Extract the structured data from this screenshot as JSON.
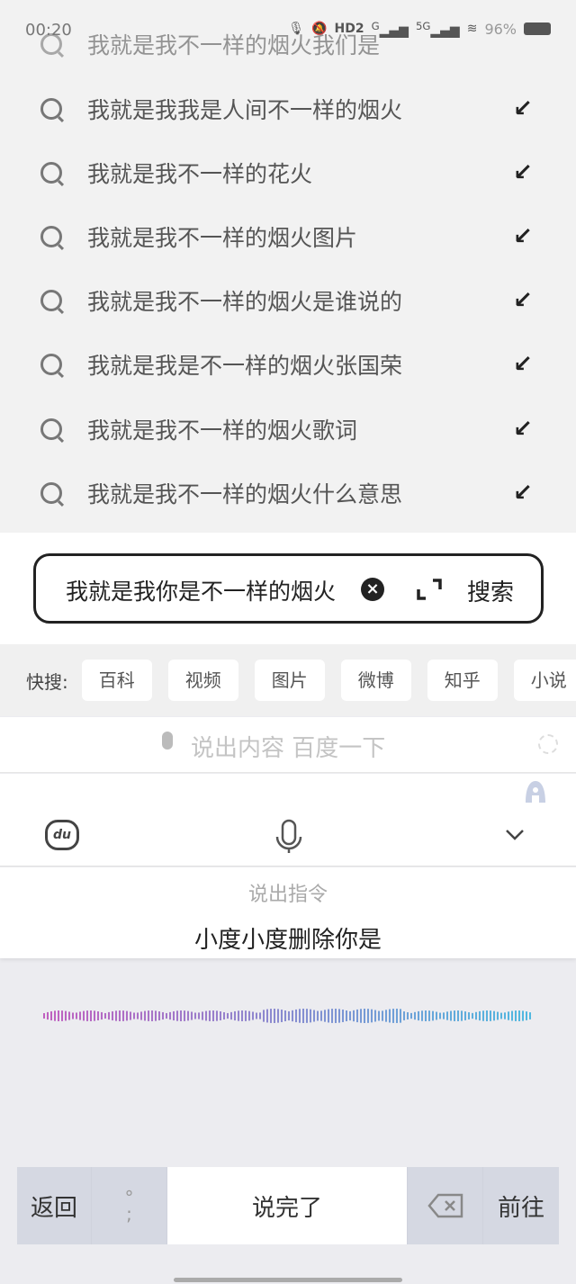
{
  "status_bar": {
    "time": "00:20",
    "signal_1": "HD2",
    "signal_2": "G",
    "signal_3": "5G",
    "battery": "96%"
  },
  "suggestions": [
    "我就是我不一样的烟火我们是",
    "我就是我我是人间不一样的烟火",
    "我就是我不一样的花火",
    "我就是我不一样的烟火图片",
    "我就是我不一样的烟火是谁说的",
    "我就是我是不一样的烟火张国荣",
    "我就是我不一样的烟火歌词",
    "我就是我不一样的烟火什么意思"
  ],
  "search": {
    "value": "我就是我你是不一样的烟火",
    "button": "搜索"
  },
  "quick_search": {
    "label": "快搜:",
    "chips": [
      "百科",
      "视频",
      "图片",
      "微博",
      "知乎",
      "小说"
    ]
  },
  "voice": {
    "hint": "说出内容 百度一下",
    "command_hint": "说出指令",
    "command": "小度小度删除你是",
    "du_logo": "du"
  },
  "keyboard": {
    "back": "返回",
    "punct": "°\n;",
    "done": "说完了",
    "go": "前往"
  },
  "colors": {
    "wave_start": "#c060c0",
    "wave_end": "#50b8e0"
  }
}
